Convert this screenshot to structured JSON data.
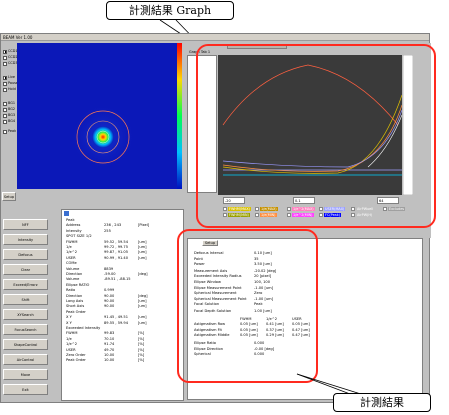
{
  "callouts": {
    "graph": "計測結果 Graph",
    "result": "計測結果"
  },
  "window": {
    "title": "BEAM Ver 1.00"
  },
  "left_checks": [
    {
      "label": "CCD1",
      "checked": true
    },
    {
      "label": "CCD2",
      "checked": false
    },
    {
      "label": "CCD3",
      "checked": false
    },
    {
      "label": "Live",
      "checked": true
    },
    {
      "label": "Pause",
      "checked": false
    },
    {
      "label": "Hold",
      "checked": false
    },
    {
      "label": "BG1",
      "checked": false
    },
    {
      "label": "BG2",
      "checked": false
    },
    {
      "label": "BG3",
      "checked": false
    },
    {
      "label": "BG4",
      "checked": false
    },
    {
      "label": "Peak",
      "checked": false
    }
  ],
  "setup_tab": "Setup",
  "buttons": [
    "NFF",
    "Intensity",
    "Defocus",
    "Clear",
    "Exceed/Errorz",
    "Shift",
    "XYSearch",
    "FocusSearch",
    "ShapeControl",
    "AirControl",
    "Move",
    "Exit"
  ],
  "center_info": [
    [
      "Peak",
      "",
      ""
    ],
    [
      "Address",
      "236 , 243",
      "[Pixel]"
    ],
    [
      "Intensity",
      "255",
      ""
    ],
    [
      "SPOT SIZE 1/2",
      "",
      ""
    ],
    [
      "FWHM",
      "59.52 , 59.54",
      "[um]"
    ],
    [
      "1/e",
      "99.72 , 99.75",
      "[um]"
    ],
    [
      "1/e^2",
      "99.87 , 91.05",
      "[um]"
    ],
    [
      "USER",
      "90.99 , 91.40",
      "[um]"
    ],
    [
      "COMe",
      "",
      ""
    ],
    [
      "Volume",
      "8839",
      ""
    ],
    [
      "Direction",
      "-59.00",
      "[deg]"
    ],
    [
      "Volume",
      "-89.51 , -88.15",
      ""
    ],
    [
      "Ellipse RATIO",
      "",
      ""
    ],
    [
      "Ratio",
      "0.999",
      ""
    ],
    [
      "Direction",
      "90.00",
      "[deg]"
    ],
    [
      "Long Axis",
      "90.00",
      "[um]"
    ],
    [
      "Short Axis",
      "90.00",
      "[um]"
    ],
    [
      "Peak Order",
      "",
      ""
    ],
    [
      "X   Y",
      "91.45 , 49.51",
      "[um]"
    ],
    [
      "X   Y",
      "89.55 , 59.94",
      "[um]"
    ],
    [
      "Exceeded Intensity",
      "",
      ""
    ],
    [
      "FWHM",
      "99.83",
      "[%]"
    ],
    [
      "1/e",
      "70.10",
      "[%]"
    ],
    [
      "1/e^2",
      "91.74",
      "[%]"
    ],
    [
      "USER",
      "49.70",
      "[%]"
    ],
    [
      "Zero Order",
      "10.00",
      "[%]"
    ],
    [
      "Peak Order",
      "10.00",
      "[%]"
    ]
  ],
  "graph": {
    "header": "Graph Tab 1",
    "x_tick_labels": [
      "-20",
      "0.1",
      "64"
    ],
    "legend": [
      {
        "label": "FWHM(MAX)",
        "color": "#d8c000"
      },
      {
        "label": "1/e(MAX)",
        "color": "#c49000"
      },
      {
        "label": "1/e^2(MAX)",
        "color": "#ff7fbf"
      },
      {
        "label": "USER(MAX)",
        "color": "#9aa0ff"
      },
      {
        "label": "AirPWuell",
        "color": "#c0c0c0"
      },
      {
        "label": "Excludes",
        "color": "#a0a0a0"
      },
      {
        "label": "FWHM(MIN)",
        "color": "#9aa000"
      },
      {
        "label": "1/e(MIN)",
        "color": "#ff8f40"
      },
      {
        "label": "1/e^2(MIN)",
        "color": "#ff40ff"
      },
      {
        "label": "FC(Peak)",
        "color": "#0000ff"
      },
      {
        "label": "AirPW(H)",
        "color": "#c0c0c0"
      }
    ]
  },
  "results": {
    "tab": "Setup",
    "rows": [
      [
        "Defocus Interval",
        "0.10  [um]"
      ],
      [
        "Point",
        "35"
      ],
      [
        "Power",
        "3.50  [um]"
      ],
      [
        "Measurement Axis",
        "-20.02  [deg]"
      ],
      [
        "Exceeded Intensity Radius",
        "20  [pixel]"
      ],
      [
        "Ellipse Window",
        "100, 100"
      ],
      [
        "Ellipse Measurement Point",
        "-1.00  [um]"
      ],
      [
        "Spherical Measurement",
        "Zero"
      ],
      [
        "Spherical Measurement Point",
        "-1.00  [um]"
      ],
      [
        "Focal Solution",
        "Peak"
      ],
      [
        "Focal Depth Solution",
        "1.00  [um]"
      ]
    ],
    "table_header": [
      "",
      "FWHM",
      "1/e^2",
      "USER"
    ],
    "table_rows": [
      [
        "Astigmatism Row",
        "0.05 [um]",
        "0.41 [um]",
        "0.05 [um]"
      ],
      [
        "Astigmatism Fit",
        "0.05 [um]",
        "0.37 [um]",
        "0.47 [um]"
      ],
      [
        "Astigmatism Middle",
        "0.05 [um]",
        "0.29 [um]",
        "0.47 [um]"
      ]
    ],
    "tail_rows": [
      [
        "Ellipse Ratio",
        "0.000"
      ],
      [
        "Ellipse Direction",
        "-0.00  [deg]"
      ],
      [
        "Spherical",
        "0.000"
      ]
    ]
  }
}
